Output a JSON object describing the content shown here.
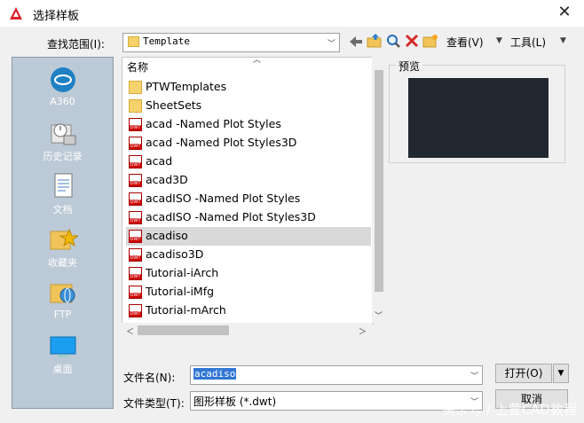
{
  "window": {
    "title": "选择样板",
    "close_label": "✕"
  },
  "lookin": {
    "label": "查找范围(I):",
    "value": "Template"
  },
  "toolbar": {
    "view_label": "查看(V)",
    "tools_label": "工具(L)"
  },
  "sidebar": {
    "items": [
      {
        "label": "A360",
        "icon": "a360-icon"
      },
      {
        "label": "历史记录",
        "icon": "history-icon"
      },
      {
        "label": "文档",
        "icon": "documents-icon"
      },
      {
        "label": "收藏夹",
        "icon": "favorites-icon"
      },
      {
        "label": "FTP",
        "icon": "ftp-icon"
      },
      {
        "label": "桌面",
        "icon": "desktop-icon"
      }
    ]
  },
  "list": {
    "column_header": "名称",
    "items": [
      {
        "name": "PTWTemplates",
        "kind": "folder"
      },
      {
        "name": "SheetSets",
        "kind": "folder"
      },
      {
        "name": "acad -Named Plot Styles",
        "kind": "dwt"
      },
      {
        "name": "acad -Named Plot Styles3D",
        "kind": "dwt"
      },
      {
        "name": "acad",
        "kind": "dwt"
      },
      {
        "name": "acad3D",
        "kind": "dwt"
      },
      {
        "name": "acadISO -Named Plot Styles",
        "kind": "dwt"
      },
      {
        "name": "acadISO -Named Plot Styles3D",
        "kind": "dwt"
      },
      {
        "name": "acadiso",
        "kind": "dwt",
        "selected": true
      },
      {
        "name": "acadiso3D",
        "kind": "dwt"
      },
      {
        "name": "Tutorial-iArch",
        "kind": "dwt"
      },
      {
        "name": "Tutorial-iMfg",
        "kind": "dwt"
      },
      {
        "name": "Tutorial-mArch",
        "kind": "dwt"
      }
    ]
  },
  "preview": {
    "label": "预览"
  },
  "filename": {
    "label": "文件名(N):",
    "value": "acadiso"
  },
  "filetype": {
    "label": "文件类型(T):",
    "value": "图形样板 (*.dwt)"
  },
  "buttons": {
    "open": "打开(O)",
    "cancel": "取消"
  },
  "watermark": "头条号 / 上萱CAD教程"
}
